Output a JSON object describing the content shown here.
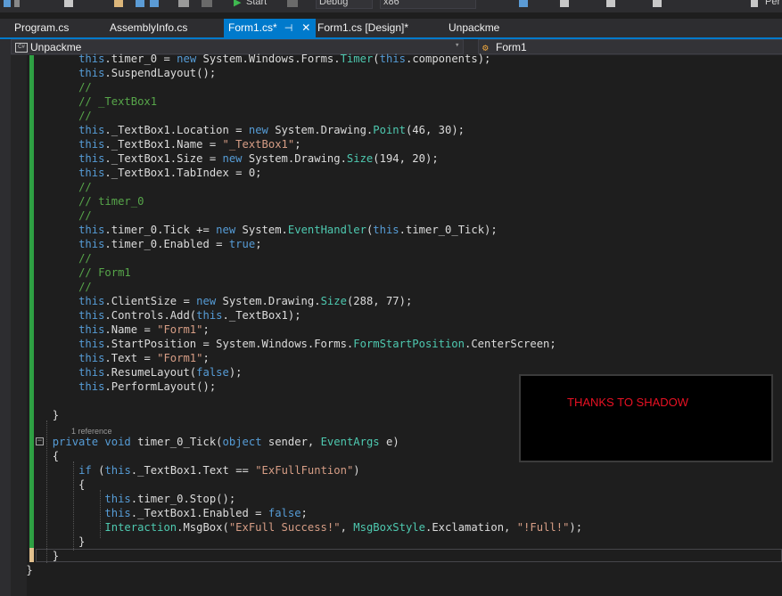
{
  "toolbar": {
    "start_label": "Start",
    "config_value": "Debug",
    "platform_value": "x86",
    "user_label": "Per"
  },
  "tabs": [
    {
      "label": "Program.cs",
      "active": false
    },
    {
      "label": "AssemblyInfo.cs",
      "active": false
    },
    {
      "label": "Form1.cs*",
      "active": true,
      "pin": "⊣",
      "close": "✕"
    },
    {
      "label": "Form1.cs [Design]*",
      "active": false
    },
    {
      "label": "Unpackme",
      "active": false
    }
  ],
  "navbar": {
    "project_badge": "C#",
    "project": "Unpackme",
    "member": "Form1"
  },
  "code": {
    "reference_label": "1 reference"
  },
  "overlay": {
    "text": "THANKS TO SHADOW"
  },
  "colors": {
    "accent": "#007acc",
    "keyword": "#569cd6",
    "type": "#4ec9b0",
    "string": "#d69d85",
    "comment": "#57a64a",
    "change_saved": "#2ea043",
    "change_unsaved": "#e2c08d",
    "overlay_text": "#e81123"
  },
  "icons": [
    "save-icon",
    "undo-icon",
    "redo-icon",
    "play-icon",
    "collapse-icon",
    "close-icon",
    "pin-icon",
    "dropdown-arrow-icon",
    "class-icon"
  ]
}
